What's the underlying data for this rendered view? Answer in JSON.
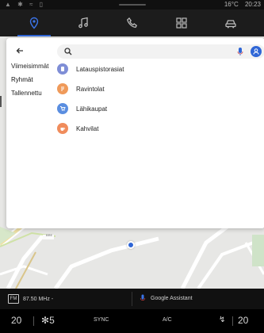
{
  "statusbar": {
    "signal_icons": "▲ ✱ ≈ ▯",
    "temperature": "16°C",
    "time": "20:23"
  },
  "nav": {
    "items": [
      {
        "name": "navigation",
        "icon": "location-pin-icon",
        "active": true
      },
      {
        "name": "music",
        "icon": "music-note-icon",
        "active": false
      },
      {
        "name": "phone",
        "icon": "phone-icon",
        "active": false
      },
      {
        "name": "apps",
        "icon": "apps-grid-icon",
        "active": false
      },
      {
        "name": "vehicle",
        "icon": "car-icon",
        "active": false
      }
    ]
  },
  "panel": {
    "search_placeholder": "",
    "tabs": [
      {
        "label": "Viimeisimmät"
      },
      {
        "label": "Ryhmät"
      },
      {
        "label": "Tallennettu"
      }
    ],
    "categories": [
      {
        "label": "Latauspistorasiat",
        "color": "#7f8ed6",
        "icon": "charging-icon"
      },
      {
        "label": "Ravintolat",
        "color": "#ef9a5a",
        "icon": "restaurant-icon"
      },
      {
        "label": "Lähikaupat",
        "color": "#5a8ee0",
        "icon": "shopping-cart-icon"
      },
      {
        "label": "Kahvilat",
        "color": "#f08c5c",
        "icon": "coffee-icon"
      }
    ]
  },
  "map": {
    "road_label": "BRE"
  },
  "infobar": {
    "radio": "87.50 MHz -",
    "radio_icon_text": "FM",
    "assistant": "Google Assistant"
  },
  "climate": {
    "left_temp": "20",
    "left_fan": "5",
    "sync": "SYNC",
    "ac": "A/C",
    "right_temp": "20"
  },
  "colors": {
    "accent": "#2f66d6",
    "background": "#1a1a1a"
  }
}
